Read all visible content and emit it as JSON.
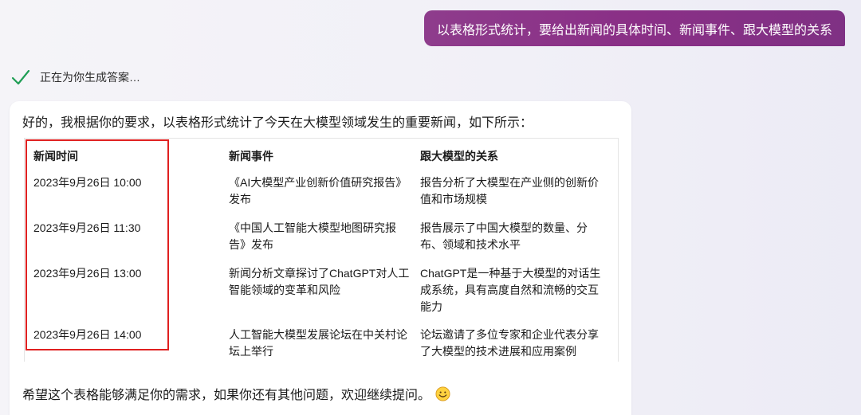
{
  "user_message": "以表格形式统计，要给出新闻的具体时间、新闻事件、跟大模型的关系",
  "status": {
    "icon": "check-icon",
    "text": "正在为你生成答案…"
  },
  "answer": {
    "intro": "好的，我根据你的要求，以表格形式统计了今天在大模型领域发生的重要新闻，如下所示：",
    "table": {
      "headers": [
        "新闻时间",
        "新闻事件",
        "跟大模型的关系"
      ],
      "rows": [
        {
          "time": "2023年9月26日 10:00",
          "event_line1": "《AI大模型产业创新价值研究报告》",
          "event_line2": "发布",
          "relation_line1": "报告分析了大模型在产业侧的创新价",
          "relation_line2": "值和市场规模",
          "relation_line3": ""
        },
        {
          "time": "2023年9月26日 11:30",
          "event_line1": "《中国人工智能大模型地图研究报",
          "event_line2": "告》发布",
          "relation_line1": "报告展示了中国大模型的数量、分",
          "relation_line2": "布、领域和技术水平",
          "relation_line3": ""
        },
        {
          "time": "2023年9月26日 13:00",
          "event_line1": "新闻分析文章探讨了ChatGPT对人工",
          "event_line2": "智能领域的变革和风险",
          "relation_line1": "ChatGPT是一种基于大模型的对话生",
          "relation_line2": "成系统，具有高度自然和流畅的交互",
          "relation_line3": "能力"
        },
        {
          "time": "2023年9月26日 14:00",
          "event_line1": "人工智能大模型发展论坛在中关村论",
          "event_line2": "坛上举行",
          "relation_line1": "论坛邀请了多位专家和企业代表分享",
          "relation_line2": "了大模型的技术进展和应用案例",
          "relation_line3": ""
        }
      ]
    },
    "outro": "希望这个表格能够满足你的需求，如果你还有其他问题，欢迎继续提问。",
    "outro_icon": "smile-emoji-icon"
  },
  "colors": {
    "user_bubble": "#8a2f86",
    "check": "#1f9e55",
    "highlight": "#e02020"
  }
}
